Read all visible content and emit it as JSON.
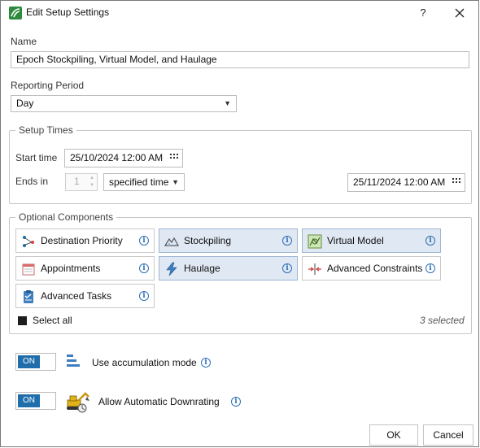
{
  "window": {
    "title": "Edit Setup Settings",
    "help_label": "?"
  },
  "name_field": {
    "label": "Name",
    "value": "Epoch Stockpiling, Virtual Model, and Haulage"
  },
  "reporting_period": {
    "label": "Reporting Period",
    "value": "Day"
  },
  "setup_times": {
    "legend": "Setup Times",
    "start_label": "Start time",
    "start_value": "25/10/2024 12:00 AM",
    "ends_label": "Ends in",
    "ends_count": "1",
    "ends_mode": "specified time",
    "end_value": "25/11/2024 12:00 AM"
  },
  "optional_components": {
    "legend": "Optional Components",
    "items": [
      {
        "label": "Destination Priority",
        "icon": "destination-priority-icon",
        "selected": false
      },
      {
        "label": "Stockpiling",
        "icon": "stockpiling-icon",
        "selected": true
      },
      {
        "label": "Virtual Model",
        "icon": "virtual-model-icon",
        "selected": true
      },
      {
        "label": "Appointments",
        "icon": "appointments-icon",
        "selected": false
      },
      {
        "label": "Haulage",
        "icon": "haulage-icon",
        "selected": true
      },
      {
        "label": "Advanced Constraints",
        "icon": "advanced-constraints-icon",
        "selected": false
      },
      {
        "label": "Advanced Tasks",
        "icon": "advanced-tasks-icon",
        "selected": false
      }
    ],
    "select_all_label": "Select all",
    "selected_count_text": "3 selected"
  },
  "accumulation": {
    "toggle_label": "ON",
    "label": "Use accumulation mode",
    "enabled": true
  },
  "downrating": {
    "toggle_label": "ON",
    "label": "Allow Automatic Downrating",
    "enabled": true
  },
  "buttons": {
    "ok": "OK",
    "cancel": "Cancel"
  },
  "colors": {
    "accent": "#1f6eab",
    "selected_bg": "#dfe8f3",
    "info": "#2f6fb3"
  }
}
